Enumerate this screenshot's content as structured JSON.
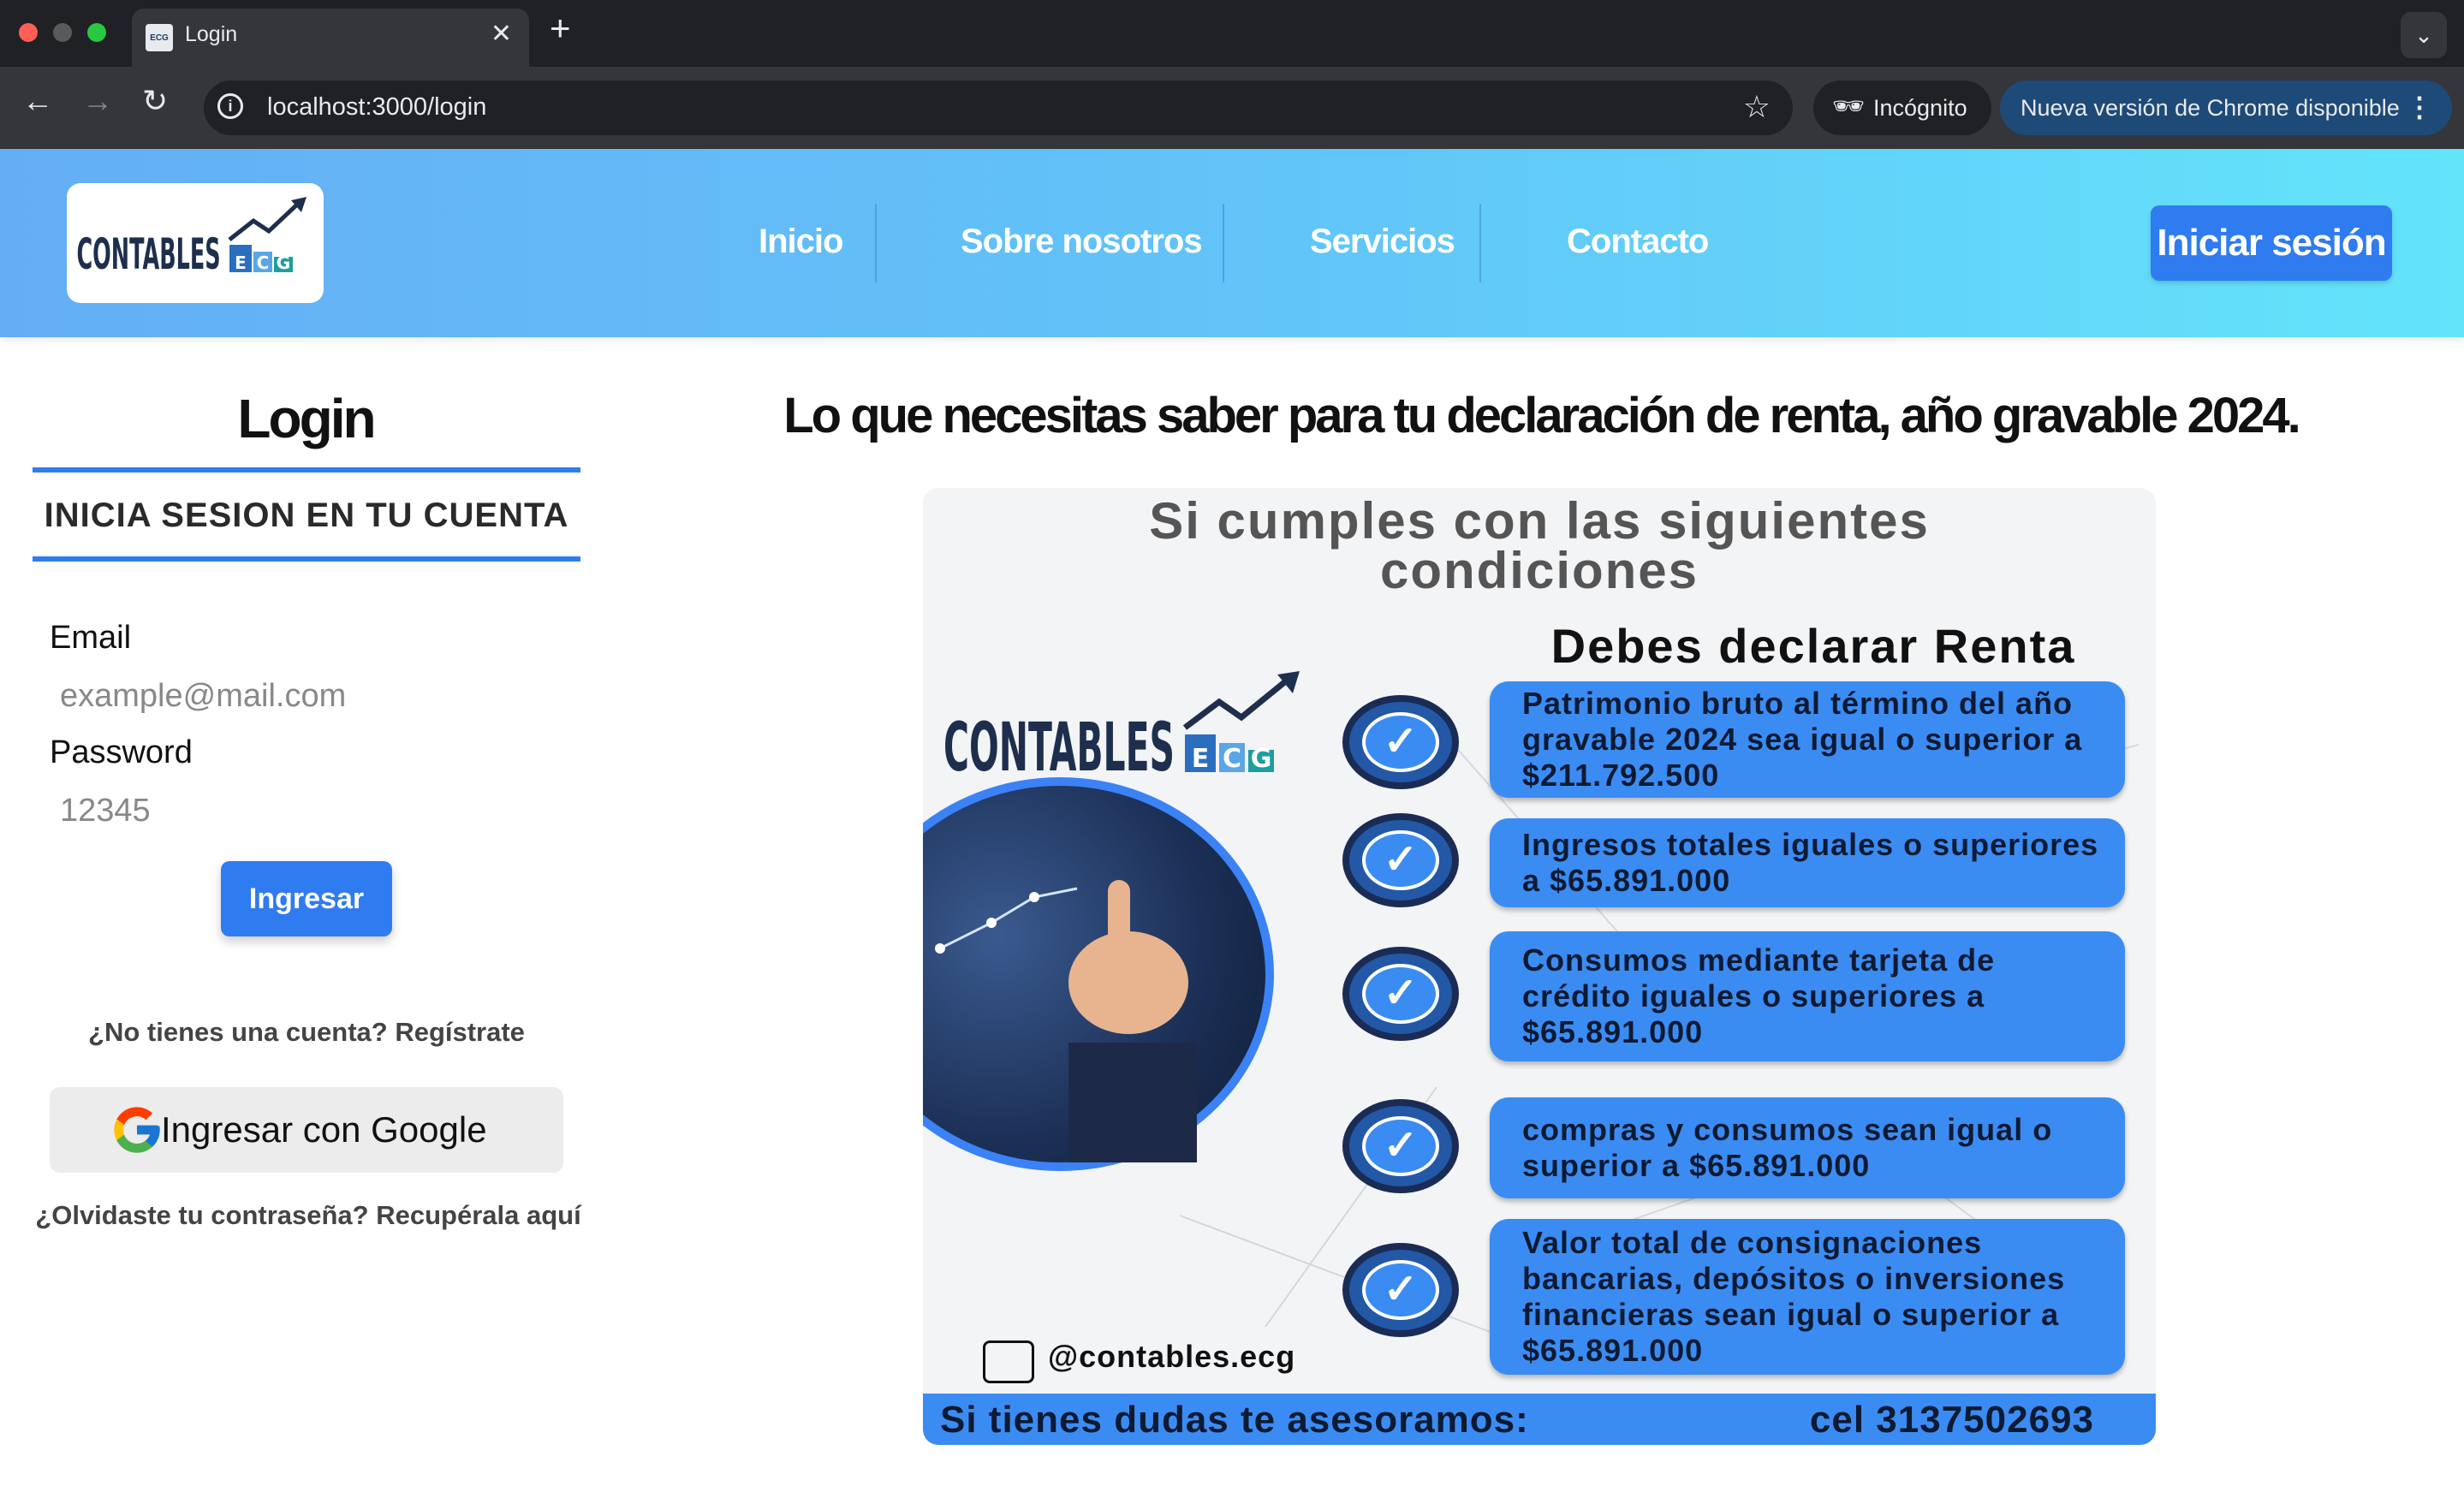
{
  "browser": {
    "tab_title": "Login",
    "url": "localhost:3000/login",
    "incognito_label": "Incógnito",
    "update_label": "Nueva versión de Chrome disponible"
  },
  "header": {
    "logo_text": "CONTABLES",
    "logo_suffix": "ECG",
    "nav": [
      "Inicio",
      "Sobre nosotros",
      "Servicios",
      "Contacto"
    ],
    "login_button": "Iniciar sesión"
  },
  "login": {
    "title": "Login",
    "subtitle": "INICIA SESION EN TU CUENTA",
    "email_label": "Email",
    "email_placeholder": "example@mail.com",
    "password_label": "Password",
    "password_placeholder": "12345",
    "submit": "Ingresar",
    "register": "¿No tienes una cuenta? Regístrate",
    "google": "Ingresar con Google",
    "forgot": "¿Olvidaste tu contraseña? Recupérala aquí"
  },
  "main": {
    "title": "Lo que necesitas saber para tu declaración de renta, año gravable 2024."
  },
  "poster": {
    "title_line1": "Si cumples con las siguientes",
    "title_line2": "condiciones",
    "subtitle": "Debes declarar Renta",
    "logo_text": "CONTABLES",
    "logo_suffix": "ECG",
    "conditions": [
      "Patrimonio bruto al término del año gravable 2024 sea igual o superior a $211.792.500",
      "Ingresos totales iguales o superiores a $65.891.000",
      "Consumos mediante tarjeta de crédito iguales o superiores a $65.891.000",
      "compras y consumos sean igual o superior a $65.891.000",
      "Valor total de consignaciones bancarias, depósitos o inversiones financieras sean igual o superior a $65.891.000"
    ],
    "handle": "@contables.ecg",
    "footer_left": "Si tienes dudas te asesoramos:",
    "footer_right": "cel 3137502693"
  },
  "colors": {
    "accent": "#2f7cf0",
    "header_gradient_start": "#64aef6",
    "header_gradient_end": "#63e4fb",
    "poster_blue": "#3b8cf2"
  }
}
